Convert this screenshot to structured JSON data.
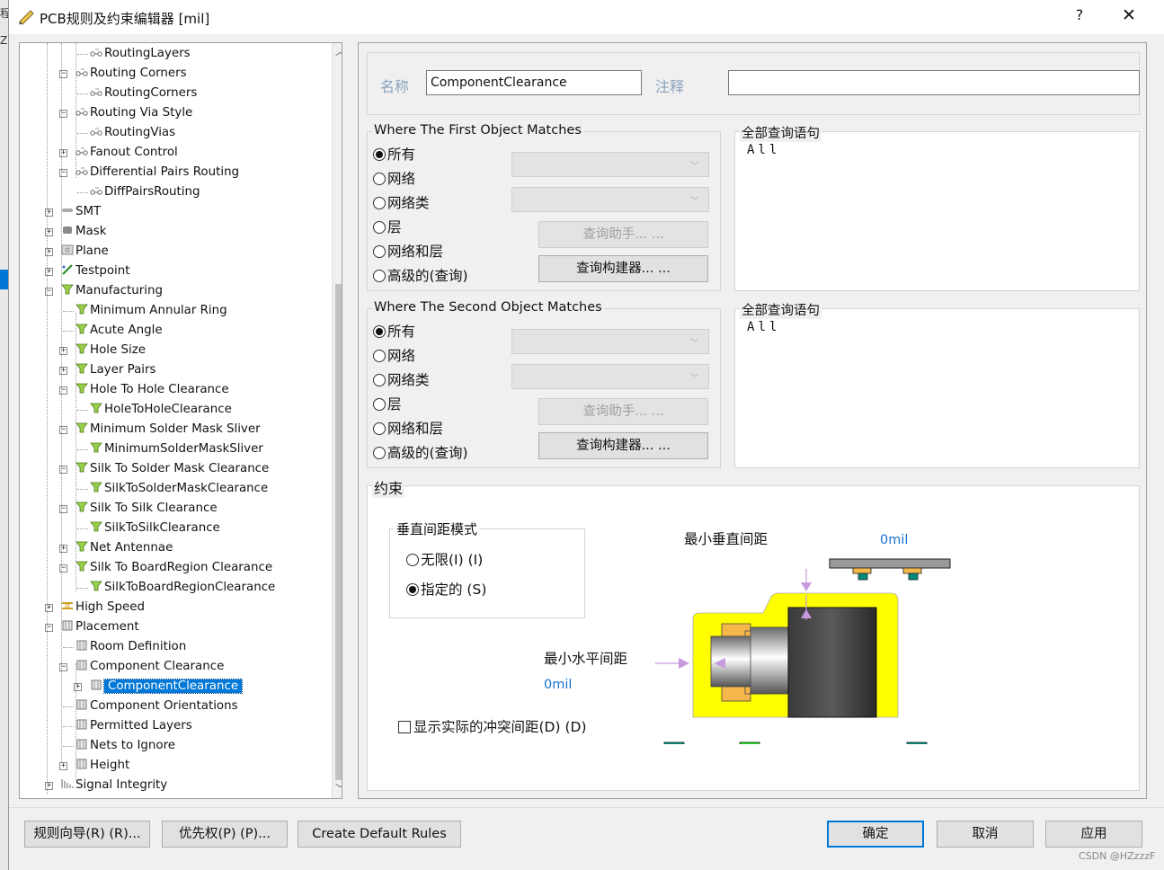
{
  "window": {
    "title": "PCB规则及约束编辑器 [mil]",
    "help_glyph": "?",
    "close_glyph": "✕"
  },
  "background_glyphs": [
    "程",
    "Z",
    "S"
  ],
  "tree": {
    "items": [
      {
        "label": "RoutingLayers"
      },
      {
        "label": "Routing Corners"
      },
      {
        "label": "RoutingCorners"
      },
      {
        "label": "Routing Via Style"
      },
      {
        "label": "RoutingVias"
      },
      {
        "label": "Fanout Control"
      },
      {
        "label": "Differential Pairs Routing"
      },
      {
        "label": "DiffPairsRouting"
      },
      {
        "label": "SMT"
      },
      {
        "label": "Mask"
      },
      {
        "label": "Plane"
      },
      {
        "label": "Testpoint"
      },
      {
        "label": "Manufacturing"
      },
      {
        "label": "Minimum Annular Ring"
      },
      {
        "label": "Acute Angle"
      },
      {
        "label": "Hole Size"
      },
      {
        "label": "Layer Pairs"
      },
      {
        "label": "Hole To Hole Clearance"
      },
      {
        "label": "HoleToHoleClearance"
      },
      {
        "label": "Minimum Solder Mask Sliver"
      },
      {
        "label": "MinimumSolderMaskSliver"
      },
      {
        "label": "Silk To Solder Mask Clearance"
      },
      {
        "label": "SilkToSolderMaskClearance"
      },
      {
        "label": "Silk To Silk Clearance"
      },
      {
        "label": "SilkToSilkClearance"
      },
      {
        "label": "Net Antennae"
      },
      {
        "label": "Silk To BoardRegion Clearance"
      },
      {
        "label": "SilkToBoardRegionClearance"
      },
      {
        "label": "High Speed"
      },
      {
        "label": "Placement"
      },
      {
        "label": "Room Definition"
      },
      {
        "label": "Component Clearance"
      },
      {
        "label": "ComponentClearance"
      },
      {
        "label": "Component Orientations"
      },
      {
        "label": "Permitted Layers"
      },
      {
        "label": "Nets to Ignore"
      },
      {
        "label": "Height"
      },
      {
        "label": "Signal Integrity"
      }
    ]
  },
  "rule": {
    "name_label": "名称",
    "name_value": "ComponentClearance",
    "comment_label": "注释",
    "comment_value": ""
  },
  "first_match": {
    "title": "Where The First Object Matches",
    "options": [
      "所有",
      "网络",
      "网络类",
      "层",
      "网络和层",
      "高级的(查询)"
    ],
    "selected": "所有",
    "query_helper": "查询助手... ...",
    "query_builder": "查询构建器... ...",
    "full_query_title": "全部查询语句",
    "full_query": "All"
  },
  "second_match": {
    "title": "Where The Second Object Matches",
    "options": [
      "所有",
      "网络",
      "网络类",
      "层",
      "网络和层",
      "高级的(查询)"
    ],
    "selected": "所有",
    "query_helper": "查询助手... ...",
    "query_builder": "查询构建器... ...",
    "full_query_title": "全部查询语句",
    "full_query": "All"
  },
  "constraints": {
    "title": "约束",
    "vertical_mode_title": "垂直间距模式",
    "opt_infinite": "无限(I) (I)",
    "opt_specified": "指定的 (S)",
    "selected": "指定的 (S)",
    "min_vertical_label": "最小垂直间距",
    "min_vertical_value": "0mil",
    "min_horizontal_label": "最小水平间距",
    "min_horizontal_value": "0mil",
    "show_actual_label": "显示实际的冲突间距(D) (D)",
    "show_actual_checked": false
  },
  "footer": {
    "rule_wizard": "规则向导(R) (R)...",
    "priorities": "优先权(P) (P)...",
    "create_defaults": "Create Default Rules",
    "ok": "确定",
    "cancel": "取消",
    "apply": "应用",
    "watermark": "CSDN @HZzzzF"
  },
  "colors": {
    "selection": "#0078d7",
    "keepout_yellow": "#ffff00",
    "board_green": "#d9e3a8",
    "pad_orange": "#f5b74a",
    "pad_teal": "#008c7a",
    "pad_green": "#22dd22",
    "arrow_violet": "#c79ae0",
    "value_blue": "#1a6fcf"
  },
  "icons": [
    "help-icon",
    "close-icon",
    "rule-icon",
    "plus-icon",
    "minus-icon",
    "chevron-down-icon",
    "scroll-up-icon",
    "scroll-down-icon"
  ]
}
